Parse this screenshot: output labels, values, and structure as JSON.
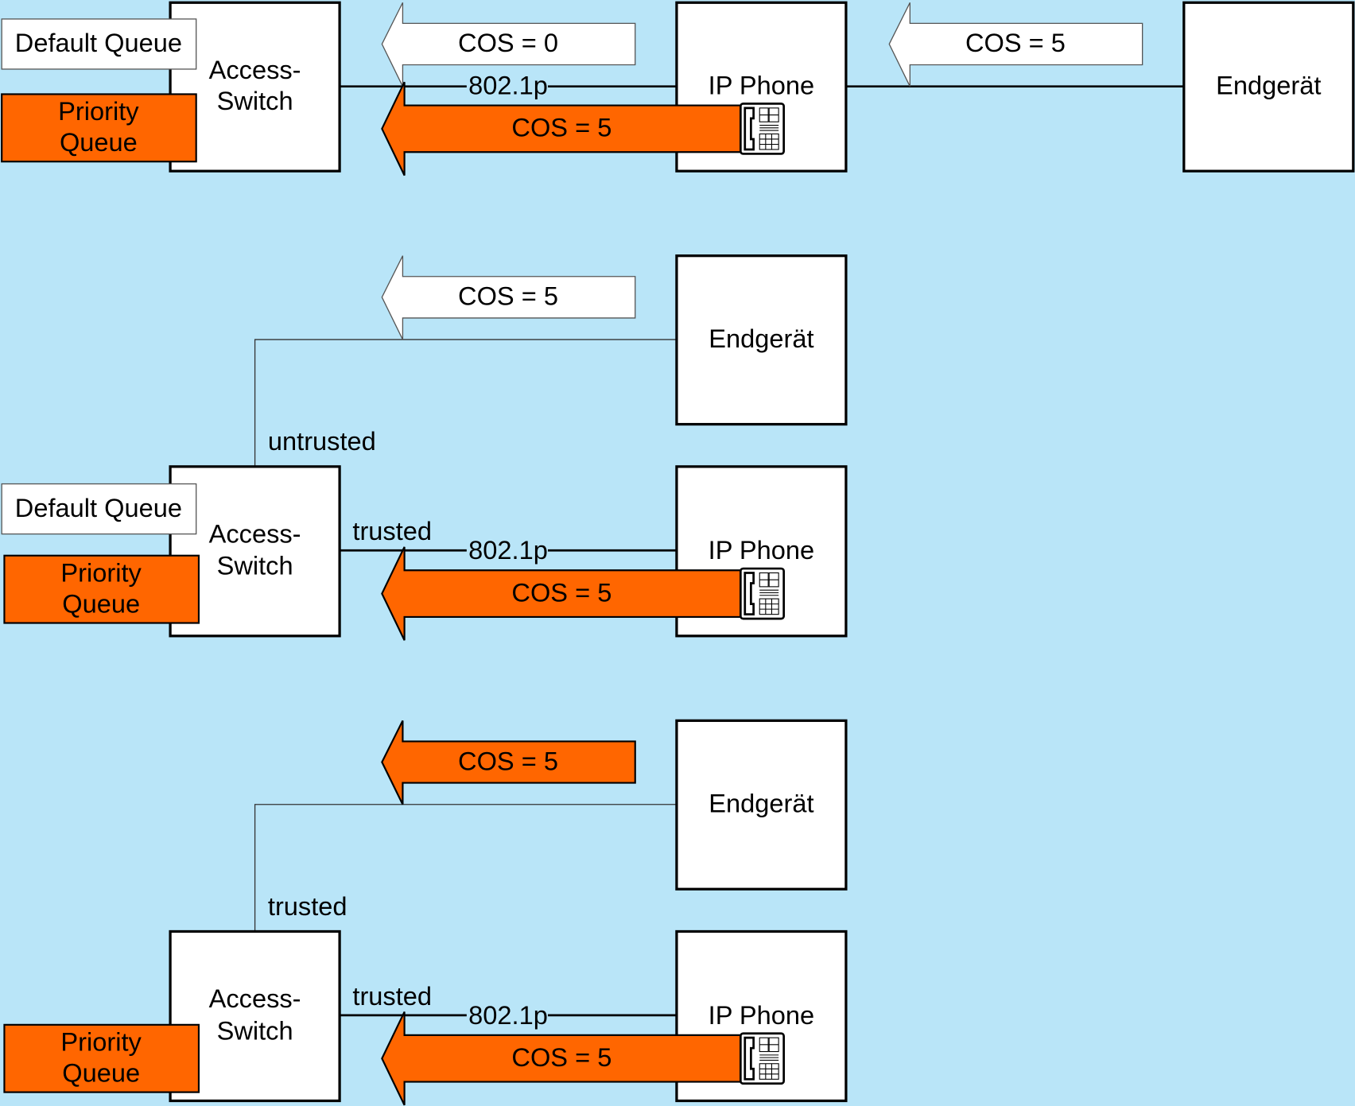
{
  "colors": {
    "background": "#b9e5f8",
    "priority": "#ff6600",
    "default": "#ffffff"
  },
  "labels": {
    "default_queue": "Default Queue",
    "priority_queue_1": "Priority",
    "priority_queue_2": "Queue",
    "switch_1": "Access-",
    "switch_2": "Switch",
    "ip_phone": "IP Phone",
    "endgeraet": "Endgerät",
    "dot1p": "802.1p",
    "cos0": "COS = 0",
    "cos5": "COS = 5",
    "untrusted": "untrusted",
    "trusted": "trusted"
  },
  "icons": {
    "phone": "telephone-icon"
  }
}
